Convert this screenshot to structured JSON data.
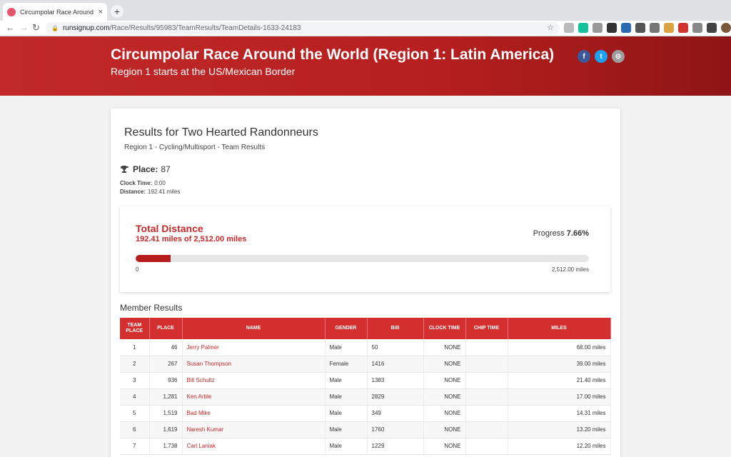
{
  "browser": {
    "tab_title": "Circumpolar Race Around the W",
    "tab_close": "×",
    "new_tab": "+",
    "url_host": "runsignup.com",
    "url_path": "/Race/Results/95983/TeamResults/TeamDetails-1633-24183"
  },
  "hero": {
    "title": "Circumpolar Race Around the World (Region 1: Latin America)",
    "subtitle": "Region 1 starts at the US/Mexican Border",
    "social": {
      "facebook": "f",
      "twitter": "t",
      "more": "⊝"
    },
    "colors": {
      "gradient_start": "#c22a2a",
      "gradient_end": "#8e1515"
    }
  },
  "results": {
    "title": "Results for Two Hearted Randonneurs",
    "subtitle": "Region 1 - Cycling/Multisport - Team Results",
    "place_label": "Place:",
    "place_value": "87",
    "clock_label": "Clock Time:",
    "clock_value": "0:00",
    "distance_label": "Distance:",
    "distance_value": "192.41 miles"
  },
  "total_distance": {
    "title": "Total Distance",
    "summary": "192.41 miles of 2,512.00 miles",
    "progress_label": "Progress",
    "progress_value": "7.66%",
    "progress_fraction": 0.0766,
    "axis_min": "0",
    "axis_max": "2,512.00 miles"
  },
  "members": {
    "title": "Member Results",
    "columns": [
      "TEAM PLACE",
      "PLACE",
      "NAME",
      "GENDER",
      "BIB",
      "CLOCK TIME",
      "CHIP TIME",
      "MILES"
    ],
    "rows": [
      {
        "team_place": "1",
        "place": "46",
        "name": "Jerry Palmer",
        "gender": "Male",
        "bib": "50",
        "clock": "NONE",
        "chip": "",
        "miles": "68.00 miles"
      },
      {
        "team_place": "2",
        "place": "267",
        "name": "Susan Thompson",
        "gender": "Female",
        "bib": "1416",
        "clock": "NONE",
        "chip": "",
        "miles": "39.00 miles"
      },
      {
        "team_place": "3",
        "place": "936",
        "name": "Bill Schultz",
        "gender": "Male",
        "bib": "1383",
        "clock": "NONE",
        "chip": "",
        "miles": "21.40 miles"
      },
      {
        "team_place": "4",
        "place": "1,281",
        "name": "Ken Arble",
        "gender": "Male",
        "bib": "2829",
        "clock": "NONE",
        "chip": "",
        "miles": "17.00 miles"
      },
      {
        "team_place": "5",
        "place": "1,519",
        "name": "Bad Mike",
        "gender": "Male",
        "bib": "349",
        "clock": "NONE",
        "chip": "",
        "miles": "14.31 miles"
      },
      {
        "team_place": "6",
        "place": "1,619",
        "name": "Naresh Kumar",
        "gender": "Male",
        "bib": "1760",
        "clock": "NONE",
        "chip": "",
        "miles": "13.20 miles"
      },
      {
        "team_place": "7",
        "place": "1,738",
        "name": "Carl Laniak",
        "gender": "Male",
        "bib": "1229",
        "clock": "NONE",
        "chip": "",
        "miles": "12.20 miles"
      }
    ]
  }
}
